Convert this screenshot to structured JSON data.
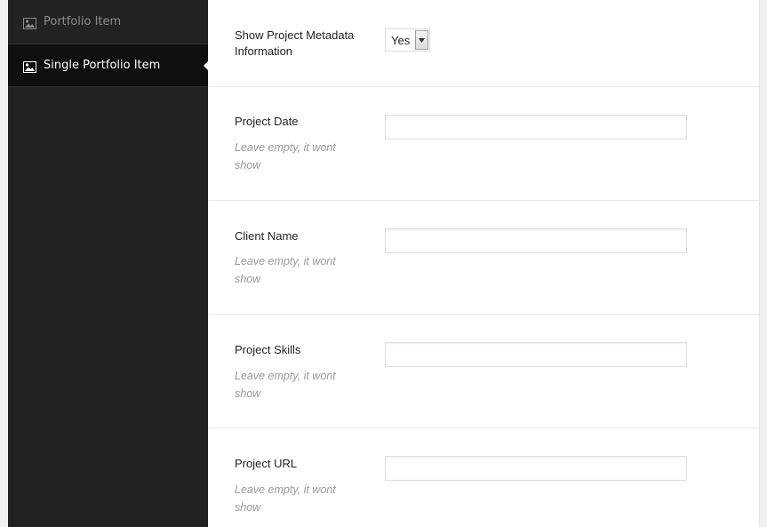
{
  "sidebar": {
    "items": [
      {
        "label": "Portfolio Item",
        "icon": "image-icon",
        "active": false
      },
      {
        "label": "Single Portfolio Item",
        "icon": "image-icon",
        "active": true
      }
    ]
  },
  "fields": {
    "show_metadata": {
      "label": "Show Project Metadata Information",
      "value": "Yes"
    },
    "project_date": {
      "label": "Project Date",
      "description": "Leave empty, it wont show",
      "value": ""
    },
    "client_name": {
      "label": "Client Name",
      "description": "Leave empty, it wont show",
      "value": ""
    },
    "project_skills": {
      "label": "Project Skills",
      "description": "Leave empty, it wont show",
      "value": ""
    },
    "project_url": {
      "label": "Project URL",
      "description": "Leave empty, it wont show",
      "value": ""
    }
  },
  "colors": {
    "sidebar_bg": "#222222",
    "sidebar_active_bg": "#0f0f0f",
    "label_text": "#222222",
    "description_text": "#999999"
  }
}
